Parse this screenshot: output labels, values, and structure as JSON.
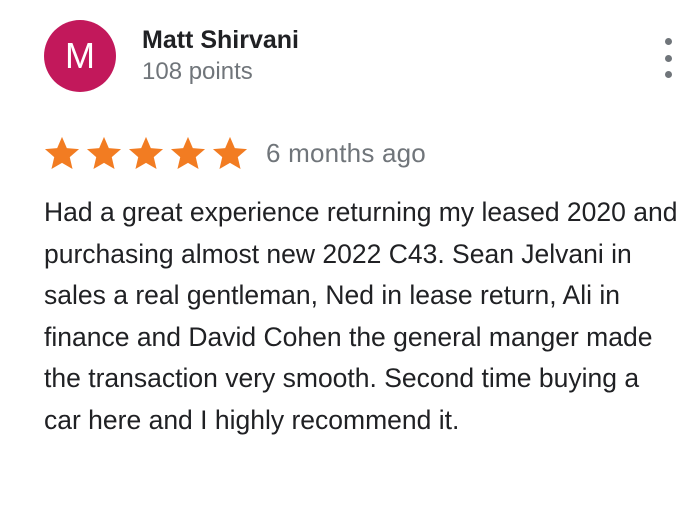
{
  "review": {
    "author": {
      "initial": "M",
      "name": "Matt Shirvani",
      "points": "108 points",
      "avatar_color": "#c2185b"
    },
    "rating": 5,
    "max_rating": 5,
    "star_color": "#f27c22",
    "date": "6 months ago",
    "text": "Had a great experience returning my leased 2020 and purchasing almost new 2022 C43. Sean Jelvani in sales a real gentleman, Ned in lease return, Ali in finance and David Cohen the general manger made the transaction very smooth. Second time buying a car here and I highly recommend it.",
    "menu_icon": "more-vert-icon"
  }
}
